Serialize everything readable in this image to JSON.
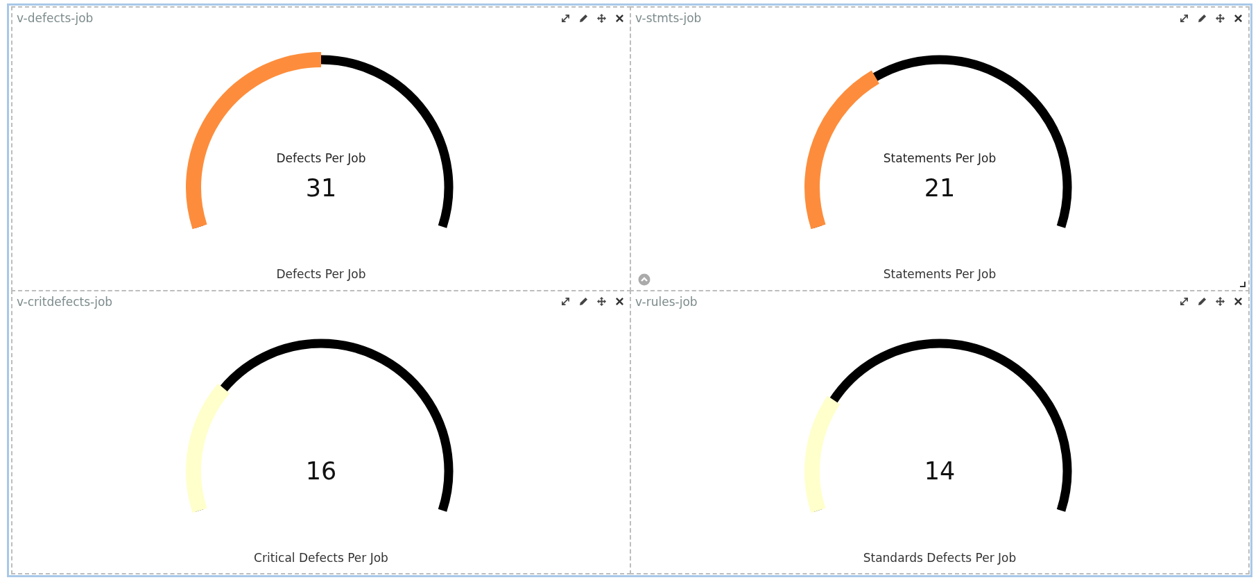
{
  "panels": [
    {
      "title": "v-defects-job",
      "gauge": {
        "label": "Defects Per Job",
        "value": "31",
        "color": "#fd8d3c"
      },
      "caption": "Defects Per Job",
      "show_handles": false
    },
    {
      "title": "v-stmts-job",
      "gauge": {
        "label": "Statements Per Job",
        "value": "21",
        "color": "#fd8d3c"
      },
      "caption": "Statements Per Job",
      "show_handles": true
    },
    {
      "title": "v-critdefects-job",
      "gauge": {
        "value": "16",
        "color": "#ffffcc"
      },
      "caption": "Critical Defects Per Job",
      "show_handles": false
    },
    {
      "title": "v-rules-job",
      "gauge": {
        "value": "14",
        "color": "#ffffcc"
      },
      "caption": "Standards Defects Per Job",
      "show_handles": false
    }
  ]
}
